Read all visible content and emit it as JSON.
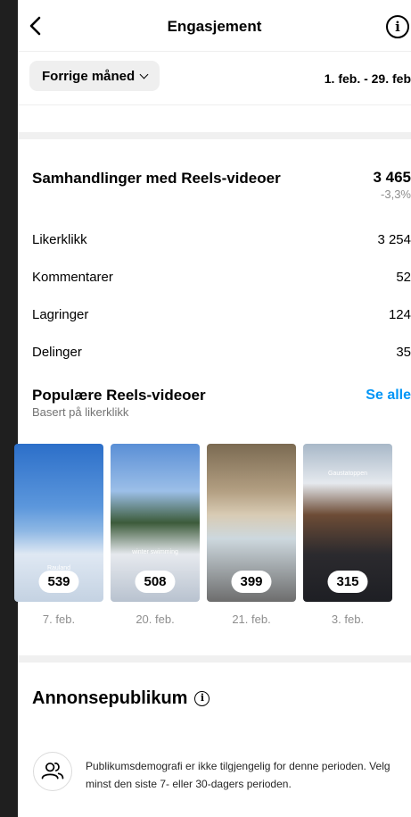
{
  "header": {
    "title": "Engasjement",
    "back_icon": "chevron-left-icon",
    "info_glyph": "i"
  },
  "filter": {
    "period_label": "Forrige måned",
    "date_range": "1. feb. - 29. feb"
  },
  "interactions": {
    "title": "Samhandlinger med Reels-videoer",
    "total": "3 465",
    "change": "-3,3%",
    "metrics": [
      {
        "label": "Likerklikk",
        "value": "3 254"
      },
      {
        "label": "Kommentarer",
        "value": "52"
      },
      {
        "label": "Lagringer",
        "value": "124"
      },
      {
        "label": "Delinger",
        "value": "35"
      }
    ]
  },
  "popular": {
    "title": "Populære Reels-videoer",
    "subtitle": "Basert på likerklikk",
    "see_all": "Se alle",
    "reels": [
      {
        "count": "539",
        "date": "7. feb.",
        "caption": "Rauland"
      },
      {
        "count": "508",
        "date": "20. feb.",
        "caption": "winter swimming"
      },
      {
        "count": "399",
        "date": "21. feb.",
        "caption": ""
      },
      {
        "count": "315",
        "date": "3. feb.",
        "caption": "Gaustatoppen"
      }
    ]
  },
  "audience": {
    "title": "Annonsepublikum",
    "info_glyph": "i",
    "message": "Publikumsdemografi er ikke tilgjengelig for denne perioden. Velg minst den siste 7- eller 30-dagers perioden."
  }
}
